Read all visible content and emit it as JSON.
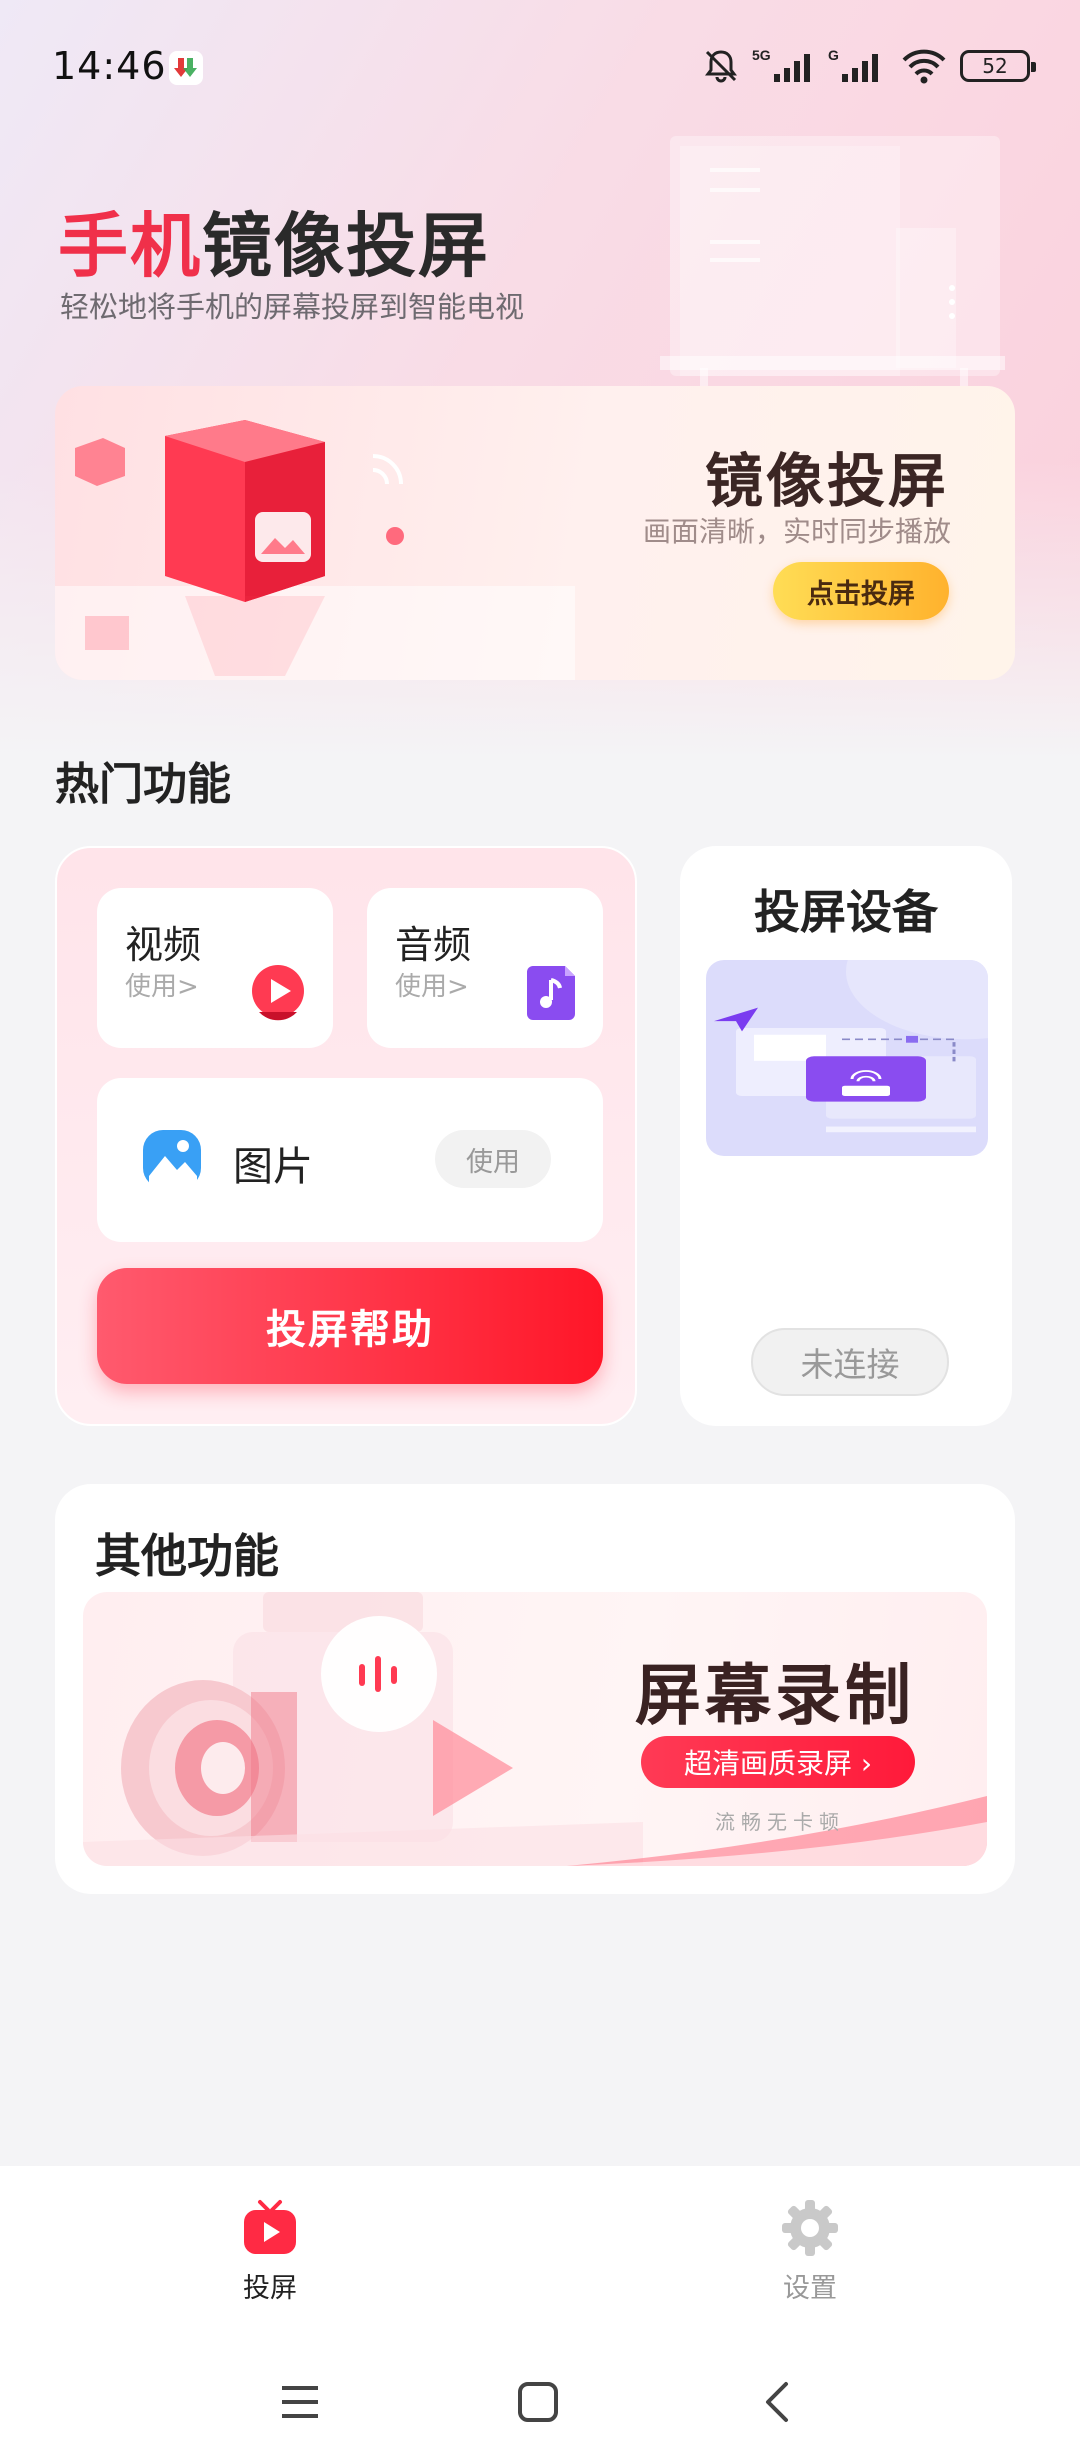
{
  "status_bar": {
    "time": "14:46",
    "signal_label_1": "5G",
    "signal_label_2": "G",
    "battery": "52",
    "icons": [
      "app-notification-icon",
      "mute-bell-icon",
      "signal-5g-icon",
      "signal-g-icon",
      "wifi-icon",
      "battery-icon"
    ]
  },
  "hero": {
    "title_accent": "手机",
    "title_rest": "镜像投屏",
    "subtitle": "轻松地将手机的屏幕投屏到智能电视"
  },
  "banner": {
    "title": "镜像投屏",
    "subtitle": "画面清晰，实时同步播放",
    "button": "点击投屏"
  },
  "hot_section": {
    "title": "热门功能",
    "video": {
      "label": "视频",
      "use": "使用>"
    },
    "audio": {
      "label": "音频",
      "use": "使用>"
    },
    "photo": {
      "label": "图片",
      "use": "使用"
    },
    "help_button": "投屏帮助"
  },
  "device": {
    "title": "投屏设备",
    "status": "未连接"
  },
  "other_section": {
    "title": "其他功能",
    "record_title": "屏幕录制",
    "record_button": "超清画质录屏 ›",
    "record_sub": "流畅无卡顿"
  },
  "bottom_nav": {
    "items": [
      {
        "label": "投屏",
        "active": true
      },
      {
        "label": "设置",
        "active": false
      }
    ]
  },
  "colors": {
    "accent": "#f0304a",
    "help_red": "#ff1628",
    "yellow_button": "#ffc83a"
  }
}
